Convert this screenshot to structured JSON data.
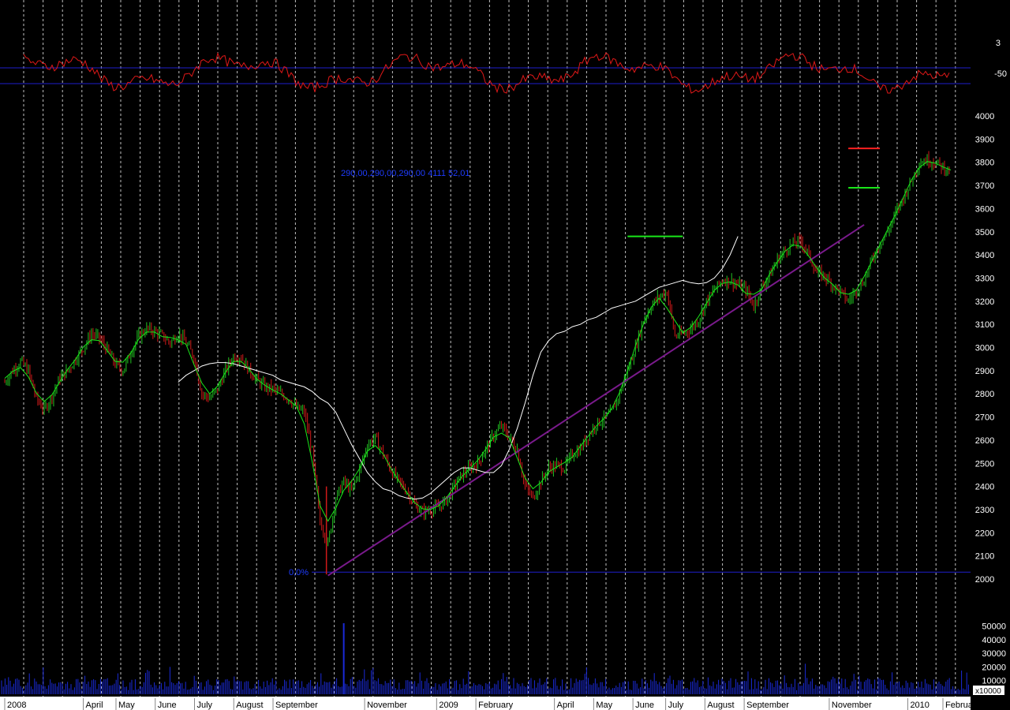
{
  "colors": {
    "background": "#000000",
    "up_bar": "#22c322",
    "down_bar": "#d01a1a",
    "fast_ma": "#19e619",
    "slow_ma": "#ffffff",
    "trendline": "#7a1a8c",
    "oscillator": "#e01818",
    "blue_lines": "#1e1ecc",
    "volume": "#1a2ad8",
    "grid": "#ffffff",
    "axis_bar": "#ffffff"
  },
  "price_panel": {
    "y_ticks": [
      "4000",
      "3900",
      "3800",
      "3700",
      "3600",
      "3500",
      "3400",
      "3300",
      "3200",
      "3100",
      "3000",
      "2900",
      "2800",
      "2700",
      "2600",
      "2500",
      "2400",
      "2300",
      "2200",
      "2100",
      "2000"
    ],
    "annotation_text": "290,00,290,00,290,00 4111 52,01",
    "fib_label": "0,0%",
    "fib_level": 2030,
    "trendline": {
      "from": {
        "week": 41,
        "price": 2015
      },
      "to": {
        "week": 109,
        "price": 3530
      }
    },
    "resistance_lines": [
      {
        "color": "#19e619",
        "from_week": 79,
        "to_week": 86,
        "price": 3480
      },
      {
        "color": "#ff2020",
        "from_week": 107,
        "to_week": 111,
        "price": 3860
      },
      {
        "color": "#19e619",
        "from_week": 107,
        "to_week": 111,
        "price": 3690
      }
    ]
  },
  "oscillator_panel": {
    "y_ticks": [
      "3",
      "-50"
    ],
    "upper_line_label": "3",
    "lower_line_label": "-50"
  },
  "volume_panel": {
    "y_ticks": [
      "50000",
      "40000",
      "30000",
      "20000",
      "10000"
    ],
    "unit_label": "x10000",
    "spike_week": 43,
    "spike_value": 52000
  },
  "x_axis": {
    "months": [
      "2008",
      "April",
      "May",
      "June",
      "July",
      "August",
      "September",
      "November",
      "2009",
      "February",
      "April",
      "May",
      "June",
      "July",
      "August",
      "September",
      "November",
      "2010",
      "February"
    ]
  },
  "chart_data": {
    "type": "line",
    "title": "",
    "x": "weekly bars, 2008 to February 2010",
    "series": [
      {
        "values": [
          2850,
          2900,
          2940,
          2900,
          2780,
          2730,
          2790,
          2870,
          2900,
          2950,
          3000,
          3060,
          3040,
          2990,
          2930,
          2900,
          2980,
          3050,
          3080,
          3070,
          3050,
          3020,
          3060,
          3020,
          2960,
          2800,
          2780,
          2820,
          2900,
          2960,
          2960,
          2900,
          2860,
          2830,
          2820,
          2800,
          2780,
          2740,
          2720,
          2550,
          2250,
          2150,
          2350,
          2420,
          2380,
          2470,
          2580,
          2610,
          2540,
          2470,
          2420,
          2380,
          2320,
          2290,
          2300,
          2310,
          2340,
          2400,
          2450,
          2480,
          2500,
          2560,
          2620,
          2660,
          2610,
          2560,
          2400,
          2350,
          2420,
          2480,
          2490,
          2480,
          2540,
          2560,
          2620,
          2670,
          2690,
          2720,
          2800,
          2900,
          3000,
          3120,
          3180,
          3220,
          3240,
          3050,
          3060,
          3080,
          3120,
          3200,
          3250,
          3290,
          3290,
          3270,
          3250,
          3180,
          3260,
          3310,
          3380,
          3420,
          3450,
          3460,
          3400,
          3320,
          3310,
          3270,
          3240,
          3200,
          3250,
          3290,
          3380,
          3450,
          3500,
          3580,
          3650,
          3720,
          3800,
          3810,
          3800,
          3780,
          3760
        ]
      },
      {
        "values": [
          null,
          null,
          null,
          null,
          null,
          null,
          null,
          null,
          null,
          null,
          null,
          null,
          null,
          null,
          null,
          null,
          2850,
          2880,
          2900,
          2920,
          2930,
          2935,
          2935,
          2930,
          2920,
          2910,
          2900,
          2890,
          2880,
          2860,
          2850,
          2840,
          2830,
          2810,
          2780,
          2760,
          2720,
          2650,
          2580,
          2520,
          2460,
          2420,
          2390,
          2380,
          2360,
          2350,
          2345,
          2350,
          2370,
          2400,
          2430,
          2460,
          2480,
          2480,
          2470,
          2460,
          2460,
          2490,
          2560,
          2650,
          2760,
          2880,
          2980,
          3030,
          3060,
          3070,
          3090,
          3100,
          3120,
          3130,
          3150,
          3170,
          3180,
          3190,
          3200,
          3220,
          3240,
          3260,
          3270,
          3280,
          3290,
          3280,
          3275,
          3280,
          3300,
          3340,
          3400,
          3480
        ]
      }
    ],
    "ylim": [
      2000,
      4000
    ],
    "xlabel": "",
    "ylabel": ""
  }
}
